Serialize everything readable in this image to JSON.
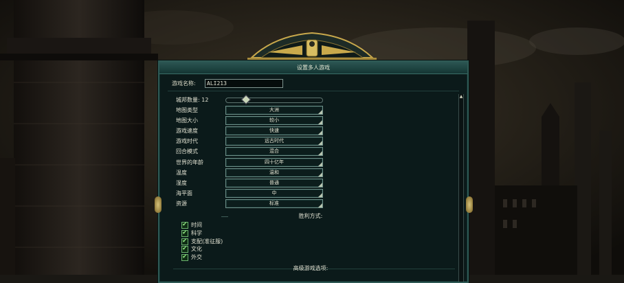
{
  "dialog": {
    "title": "设置多人游戏"
  },
  "game_name": {
    "label": "游戏名称:",
    "value": "ALI213"
  },
  "civ_count": {
    "label": "城邦数量: 12",
    "slider_fraction": 0.2
  },
  "settings": [
    {
      "label": "地图类型",
      "value": "大洲"
    },
    {
      "label": "地图大小",
      "value": "较小"
    },
    {
      "label": "游戏速度",
      "value": "快速"
    },
    {
      "label": "游戏时代",
      "value": "远古时代"
    },
    {
      "label": "回合模式",
      "value": "混合"
    },
    {
      "label": "世界的年龄",
      "value": "四十亿年"
    },
    {
      "label": "温度",
      "value": "温和"
    },
    {
      "label": "湿度",
      "value": "普通"
    },
    {
      "label": "海平面",
      "value": "中"
    },
    {
      "label": "资源",
      "value": "标准"
    }
  ],
  "victory": {
    "header": "胜利方式:",
    "items": [
      {
        "label": "时间",
        "checked": true
      },
      {
        "label": "科学",
        "checked": true
      },
      {
        "label": "支配(准征服)",
        "checked": true
      },
      {
        "label": "文化",
        "checked": true
      },
      {
        "label": "外交",
        "checked": true
      }
    ]
  },
  "advanced": {
    "header": "高级游戏选项:"
  },
  "colors": {
    "panel_bg": "#0b1a1a",
    "panel_border": "#2f5a55",
    "gold": "#c9a94c",
    "check_green": "#8be07e"
  }
}
